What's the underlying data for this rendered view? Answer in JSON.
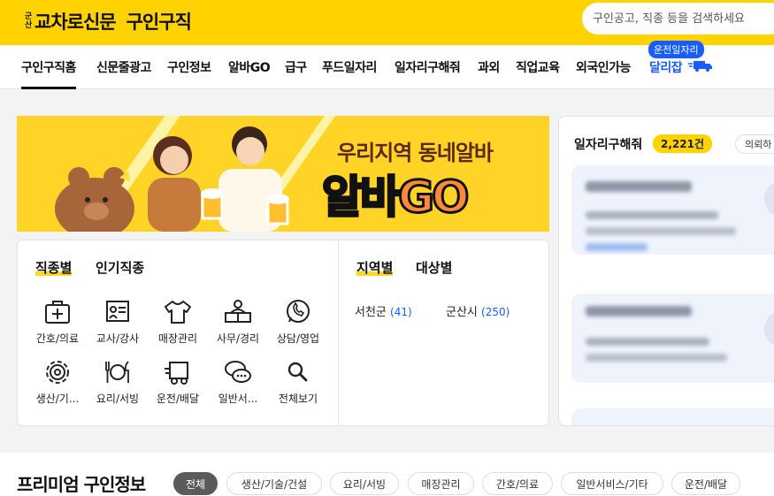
{
  "header": {
    "logo_small": "군산",
    "logo_main": "교차로신문",
    "logo_sub": "구인구직",
    "search_placeholder": "구인공고, 직종 등을 검색하세요"
  },
  "nav": {
    "items": [
      "구인구직홈",
      "신문줄광고",
      "구인정보",
      "알바GO",
      "급구",
      "푸드일자리",
      "일자리구해줘",
      "과외",
      "직업교육",
      "외국인가능",
      "달리잡"
    ],
    "badge": "운전일자리"
  },
  "banner": {
    "line1": "우리지역 동네알바",
    "big_a": "알바",
    "big_b": "GO"
  },
  "categories": {
    "tabs": [
      "직종별",
      "인기직종"
    ],
    "items": [
      {
        "label": "간호/의료",
        "icon": "medical-kit-icon"
      },
      {
        "label": "교사/강사",
        "icon": "teacher-board-icon"
      },
      {
        "label": "매장관리",
        "icon": "shirt-icon"
      },
      {
        "label": "사무/경리",
        "icon": "office-desk-icon"
      },
      {
        "label": "상담/영업",
        "icon": "phone-chat-icon"
      },
      {
        "label": "생산/기...",
        "icon": "gear-icon"
      },
      {
        "label": "요리/서빙",
        "icon": "dining-icon"
      },
      {
        "label": "운전/배달",
        "icon": "truck-icon"
      },
      {
        "label": "일반서...",
        "icon": "chat-bubbles-icon"
      },
      {
        "label": "전체보기",
        "icon": "search-icon"
      }
    ],
    "region_tabs": [
      "지역별",
      "대상별"
    ],
    "regions": [
      {
        "name": "서천군",
        "count": "(41)"
      },
      {
        "name": "군산시",
        "count": "(250)"
      }
    ]
  },
  "right_panel": {
    "title": "일자리구해줘",
    "count": "2,221건",
    "chip": "의뢰하"
  },
  "premium": {
    "title": "프리미엄 구인정보",
    "chips": [
      "전체",
      "생산/기술/건설",
      "요리/서빙",
      "매장관리",
      "간호/의료",
      "일반서비스/기타",
      "운전/배달"
    ]
  },
  "colors": {
    "brand_yellow": "#ffd200",
    "accent_blue": "#1a5dff"
  }
}
